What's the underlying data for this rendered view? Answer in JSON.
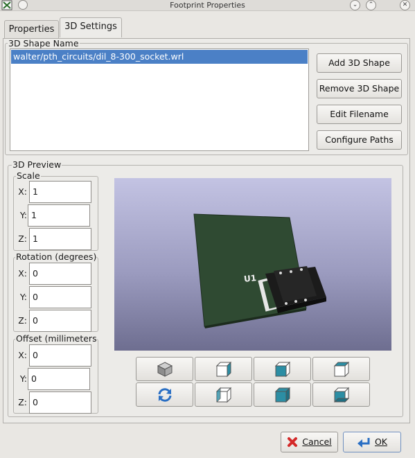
{
  "window": {
    "title": "Footprint Properties"
  },
  "tabs": [
    {
      "label": "Properties"
    },
    {
      "label": "3D Settings"
    }
  ],
  "shape_name_group": {
    "title": "3D Shape Name",
    "items": [
      "walter/pth_circuits/dil_8-300_socket.wrl"
    ],
    "buttons": {
      "add": "Add 3D Shape",
      "remove": "Remove 3D Shape",
      "edit": "Edit Filename",
      "configure": "Configure Paths"
    }
  },
  "preview_group": {
    "title": "3D Preview",
    "scale": {
      "title": "Scale",
      "x_label": "X:",
      "y_label": "Y:",
      "z_label": "Z:",
      "x": "1",
      "y": "1",
      "z": "1"
    },
    "rotation": {
      "title": "Rotation (degrees)",
      "x_label": "X:",
      "y_label": "Y:",
      "z_label": "Z:",
      "x": "0",
      "y": "0",
      "z": "0"
    },
    "offset": {
      "title": "Offset (millimeters)",
      "x_label": "X:",
      "y_label": "Y:",
      "z_label": "Z:",
      "x": "0",
      "y": "0",
      "z": "0"
    },
    "viewport": {
      "component_label": "U1"
    },
    "view_buttons": [
      {
        "icon": "view-iso-icon"
      },
      {
        "icon": "view-left-icon"
      },
      {
        "icon": "view-front-icon"
      },
      {
        "icon": "view-top-icon"
      },
      {
        "icon": "reload-icon"
      },
      {
        "icon": "view-right-icon"
      },
      {
        "icon": "view-back-icon"
      },
      {
        "icon": "view-bottom-icon"
      }
    ]
  },
  "footer": {
    "cancel_label": "Cancel",
    "ok_label": "OK"
  },
  "colors": {
    "accent": "#4b80c6",
    "board": "#2f4a32",
    "cube": "#2c8ea4",
    "cancel_icon": "#d42a2a"
  }
}
